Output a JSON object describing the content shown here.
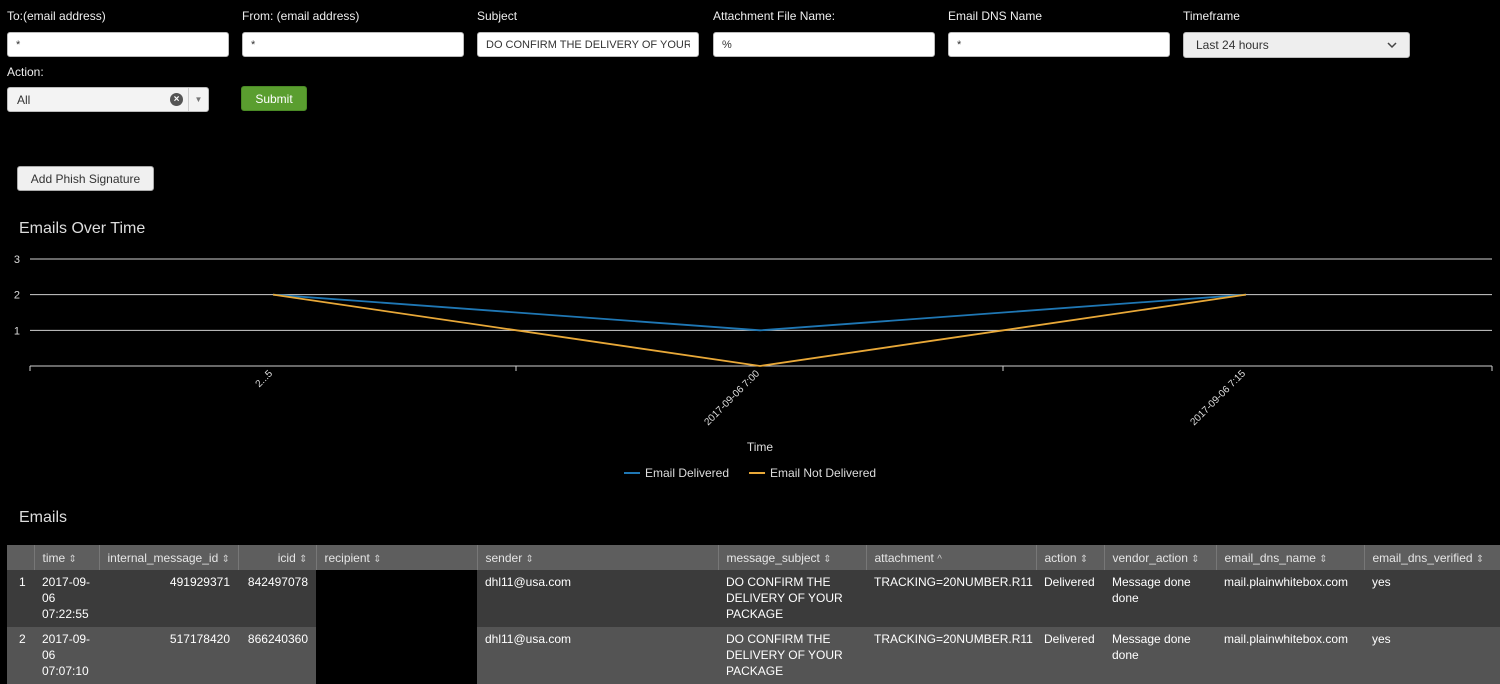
{
  "filters": {
    "to": {
      "label": "To:(email address)",
      "value": "*"
    },
    "from": {
      "label": "From: (email address)",
      "value": "*"
    },
    "subject": {
      "label": "Subject",
      "value": "DO CONFIRM THE DELIVERY OF YOUR PACKAGE"
    },
    "attachment": {
      "label": "Attachment File Name:",
      "value": "%"
    },
    "dns": {
      "label": "Email DNS Name",
      "value": "*"
    },
    "timeframe": {
      "label": "Timeframe",
      "value": "Last 24 hours"
    },
    "action": {
      "label": "Action:",
      "value": "All"
    },
    "submit_label": "Submit"
  },
  "add_phish_label": "Add Phish Signature",
  "chart_section_title": "Emails Over Time",
  "chart_data": {
    "type": "line",
    "title": "Emails Over Time",
    "xlabel": "Time",
    "ylabel": "",
    "categories": [
      "2...5",
      "2017-09-06 7:00",
      "2017-09-06 7:15"
    ],
    "ylim": [
      0,
      3
    ],
    "yticks": [
      1,
      2,
      3
    ],
    "grid": true,
    "legend": "bottom",
    "series": [
      {
        "name": "Email Delivered",
        "color": "#1f77b4",
        "values": [
          2,
          1,
          2
        ]
      },
      {
        "name": "Email Not Delivered",
        "color": "#e8a838",
        "values": [
          2,
          0,
          2
        ]
      }
    ]
  },
  "table_section_title": "Emails",
  "table": {
    "columns": [
      "",
      "time",
      "internal_message_id",
      "icid",
      "recipient",
      "sender",
      "message_subject",
      "attachment",
      "action",
      "vendor_action",
      "email_dns_name",
      "email_dns_verified"
    ],
    "rows": [
      {
        "index": "1",
        "time": "2017-09-06 07:22:55",
        "internal_message_id": "491929371",
        "icid": "842497078",
        "recipient": "",
        "sender": "dhl11@usa.com",
        "message_subject": "DO CONFIRM THE DELIVERY OF YOUR PACKAGE",
        "attachment": "TRACKING=20NUMBER.R11",
        "action": "Delivered",
        "vendor_action": "Message done done",
        "email_dns_name": "mail.plainwhitebox.com",
        "email_dns_verified": "yes"
      },
      {
        "index": "2",
        "time": "2017-09-06 07:07:10",
        "internal_message_id": "517178420",
        "icid": "866240360",
        "recipient": "",
        "sender": "dhl11@usa.com",
        "message_subject": "DO CONFIRM THE DELIVERY OF YOUR PACKAGE",
        "attachment": "TRACKING=20NUMBER.R11",
        "action": "Delivered",
        "vendor_action": "Message done done",
        "email_dns_name": "mail.plainwhitebox.com",
        "email_dns_verified": "yes"
      }
    ]
  }
}
